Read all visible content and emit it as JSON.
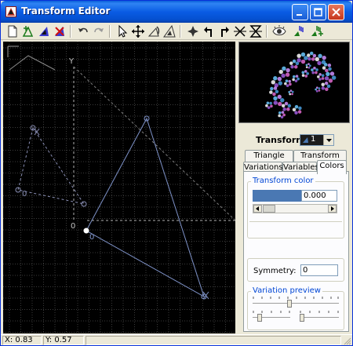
{
  "window": {
    "title": "Transform Editor"
  },
  "toolbar": {
    "tools": [
      "new-transform-icon",
      "add-transform-icon",
      "duplicate-transform-icon",
      "delete-transform-icon",
      "undo-icon",
      "redo-icon",
      "select-pointer-icon",
      "move-icon",
      "rotate-icon",
      "scale-icon",
      "flip-icon",
      "rotate-left-icon",
      "rotate-right-icon",
      "flip-horizontal-icon",
      "flip-vertical-icon",
      "eye-icon",
      "post-transform-icon",
      "post-transform-reset-icon"
    ]
  },
  "canvas": {
    "axis_y_label": "Y",
    "origin_label": "0",
    "triangle_main_vertex_label": "0",
    "triangle_ref_vertex_label": "0",
    "background": "#000000",
    "grid_color": "#3a3a3a",
    "main_triangle_color": "#7f93c9",
    "reference_color": "#9a9a9a"
  },
  "panel": {
    "transform_label": "Transform",
    "transform_value": "1",
    "tabs_top": [
      "Triangle",
      "Transform"
    ],
    "tabs_bottom": [
      "Variations",
      "Variables",
      "Colors"
    ],
    "active_tab": "Colors",
    "transform_color": {
      "group_label": "Transform color",
      "swatch": "#4a78b3",
      "value": "0.000",
      "slider_fraction": 0.0
    },
    "symmetry": {
      "label": "Symmetry:",
      "value": "0"
    },
    "variation_preview": {
      "group_label": "Variation preview"
    }
  },
  "statusbar": {
    "x_readout": "X: 0.83",
    "y_readout": "Y: 0.57"
  }
}
